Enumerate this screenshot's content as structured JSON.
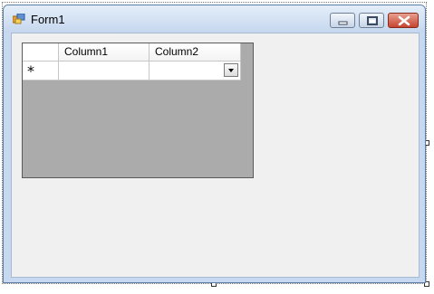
{
  "window": {
    "title": "Form1",
    "icon": "form-icon",
    "controls": {
      "minimize_icon": "minimize-icon",
      "maximize_icon": "maximize-icon",
      "close_icon": "close-icon"
    }
  },
  "grid": {
    "columns": [
      "Column1",
      "Column2"
    ],
    "new_row_marker": "*",
    "rows": [
      {
        "column1": "",
        "column2": ""
      }
    ],
    "column2_type": "combobox"
  },
  "colors": {
    "client_background": "#f0f0f0",
    "grid_background": "#ababab",
    "close_button": "#c6452f"
  }
}
